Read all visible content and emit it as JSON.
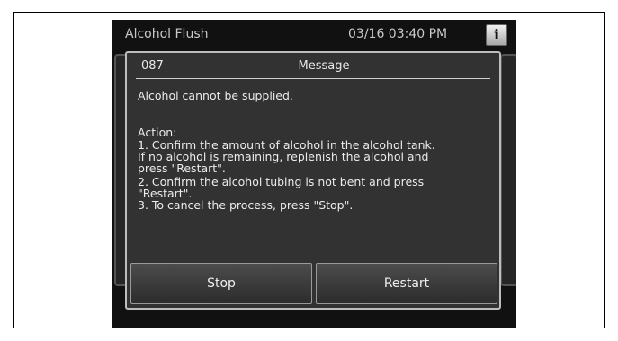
{
  "screen": {
    "title": "Alcohol Flush",
    "datetime": "03/16 03:40 PM",
    "info_icon": "i"
  },
  "dialog": {
    "code": "087",
    "title": "Message",
    "message": "Alcohol cannot be supplied.",
    "action_label": "Action:",
    "action_lines": [
      "1. Confirm the amount of alcohol in the alcohol tank.",
      "If no alcohol is remaining, replenish the alcohol and",
      "press \"Restart\".",
      "2. Confirm the alcohol tubing is not bent and press",
      "\"Restart\".",
      "3. To cancel the process, press \"Stop\"."
    ],
    "buttons": {
      "stop": "Stop",
      "restart": "Restart"
    }
  }
}
